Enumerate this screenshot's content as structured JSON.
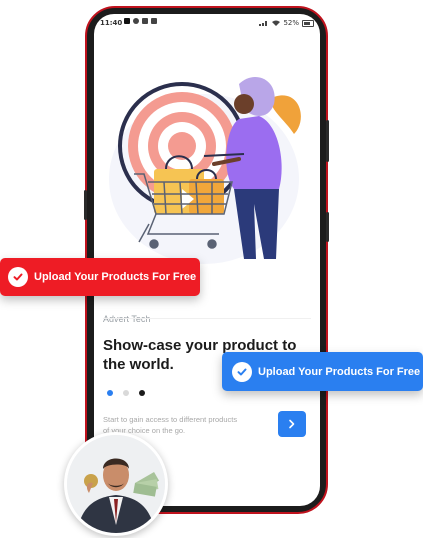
{
  "status_bar": {
    "time": "11:40",
    "right": "52%"
  },
  "screen": {
    "brand_label": "Advert Tech",
    "headline": "Show-case your product to the world.",
    "description": "Start to gain access to different products of your choice on the go.",
    "pager": {
      "total": 3,
      "active_index": 0
    },
    "next_button_icon": "chevron-right-icon"
  },
  "badges": {
    "red": {
      "label": "Upload Your Products For Free",
      "icon": "check-circle-icon",
      "color": "#ee1c25"
    },
    "blue": {
      "label": "Upload Your Products For Free",
      "icon": "check-circle-icon",
      "color": "#2a7ff0"
    }
  },
  "colors": {
    "accent": "#2a7ff0",
    "frame": "#c0121d",
    "dot_active": "#2a7ff0",
    "dot_inactive": "#d9d9d9",
    "dot_dark": "#1b1b1b"
  }
}
